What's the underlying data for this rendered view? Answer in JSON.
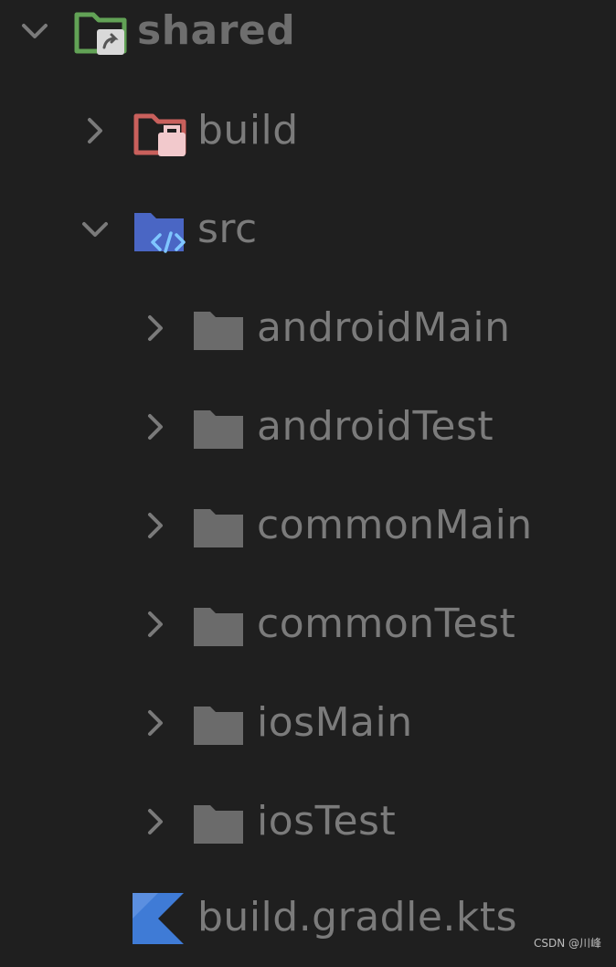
{
  "tree": {
    "root": {
      "label": "shared",
      "expanded": true,
      "icon": "module-folder-icon"
    },
    "build_dir": {
      "label": "build",
      "expanded": false,
      "icon": "excluded-folder-icon"
    },
    "src_dir": {
      "label": "src",
      "expanded": true,
      "icon": "source-folder-icon"
    },
    "src_children": [
      {
        "label": "androidMain",
        "expanded": false,
        "icon": "folder-icon"
      },
      {
        "label": "androidTest",
        "expanded": false,
        "icon": "folder-icon"
      },
      {
        "label": "commonMain",
        "expanded": false,
        "icon": "folder-icon"
      },
      {
        "label": "commonTest",
        "expanded": false,
        "icon": "folder-icon"
      },
      {
        "label": "iosMain",
        "expanded": false,
        "icon": "folder-icon"
      },
      {
        "label": "iosTest",
        "expanded": false,
        "icon": "folder-icon"
      }
    ],
    "gradle_file": {
      "label": "build.gradle.kts",
      "icon": "kotlin-file-icon"
    }
  },
  "colors": {
    "background": "#1f1f1f",
    "text": "#7b7b7b",
    "chevron": "#7a7a7a",
    "module_green": "#62a256",
    "excluded_red": "#c9605c",
    "source_blue": "#4a66c4",
    "kotlin_blue": "#3f7bd6"
  },
  "watermark": "CSDN @川峰"
}
